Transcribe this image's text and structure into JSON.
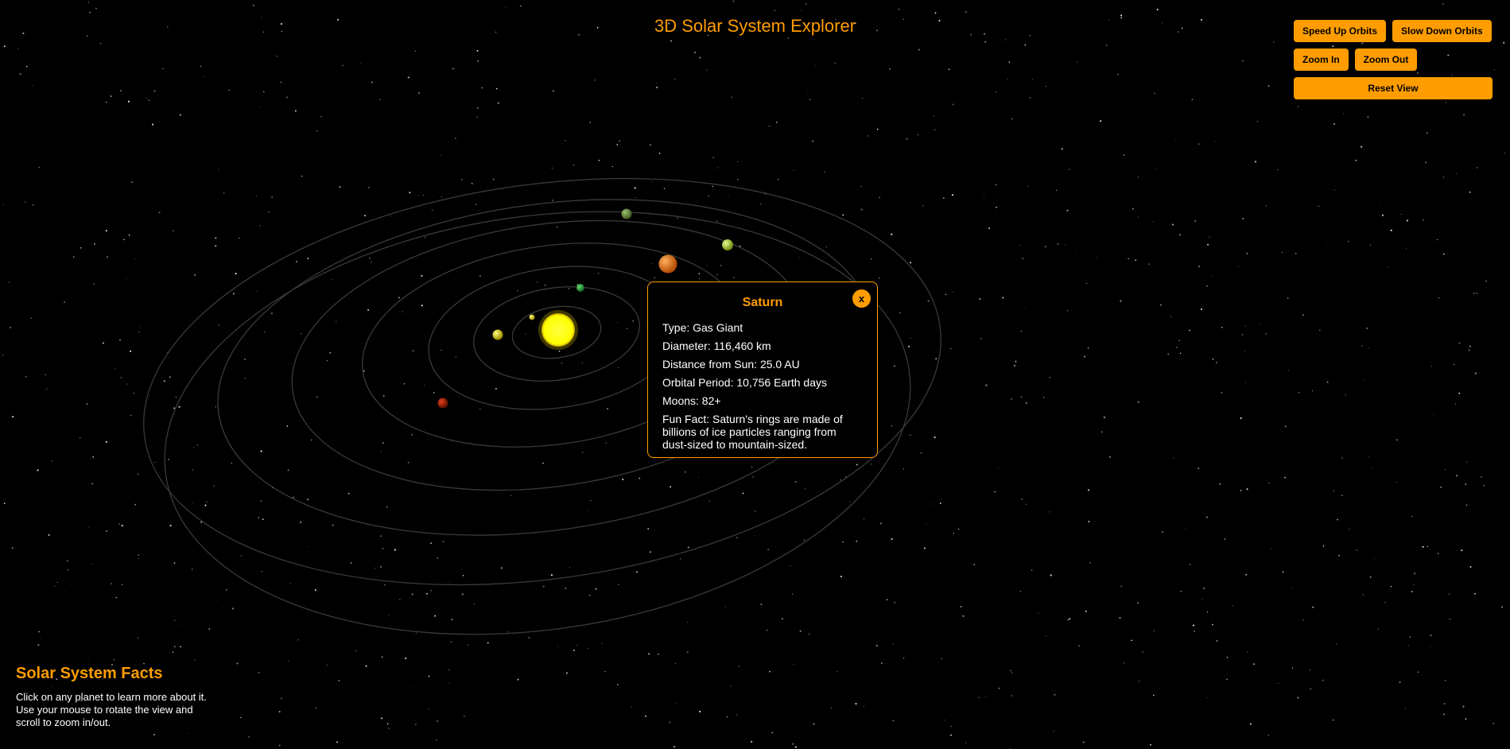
{
  "app": {
    "title": "3D Solar System Explorer"
  },
  "controls": {
    "speed_up": "Speed Up Orbits",
    "slow_down": "Slow Down Orbits",
    "zoom_in": "Zoom In",
    "zoom_out": "Zoom Out",
    "reset": "Reset View"
  },
  "info_panel": {
    "planet": "Saturn",
    "close_label": "x",
    "type": "Type: Gas Giant",
    "diameter": "Diameter: 116,460 km",
    "distance": "Distance from Sun: 25.0 AU",
    "orbital_period": "Orbital Period: 10,756 Earth days",
    "moons": "Moons: 82+",
    "fun_fact": "Fun Fact: Saturn's rings are made of billions of ice particles ranging from dust-sized to mountain-sized."
  },
  "facts": {
    "heading": "Solar System Facts",
    "body": "Click on any planet to learn more about it. Use your mouse to rotate the view and scroll to zoom in/out."
  },
  "colors": {
    "accent": "#ff9d00",
    "background": "#000000",
    "sun": "#ffff00",
    "orbit": "#3a3a3a"
  },
  "icons": {
    "close": "close-icon"
  }
}
